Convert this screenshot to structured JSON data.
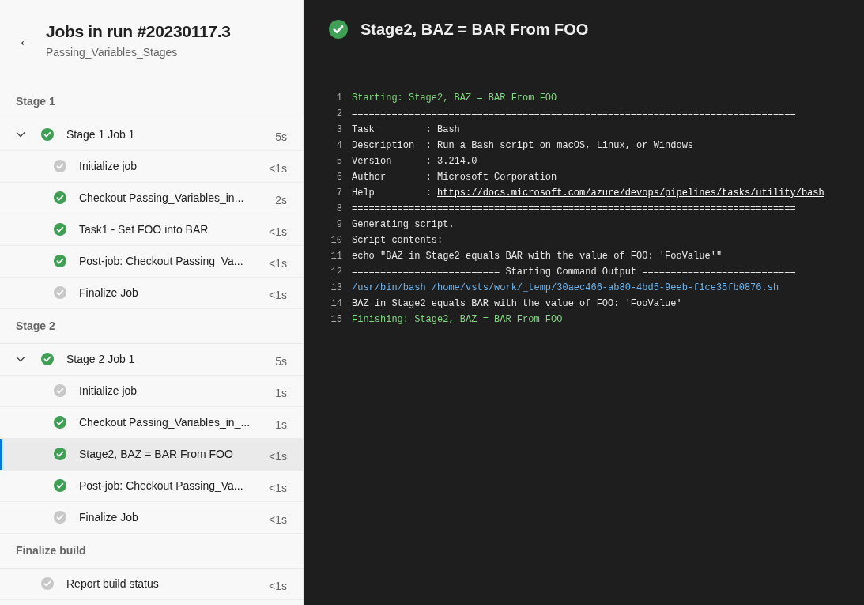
{
  "header": {
    "back": "←",
    "title": "Jobs in run #20230117.3",
    "subtitle": "Passing_Variables_Stages"
  },
  "stages": [
    {
      "name": "Stage 1",
      "jobs": [
        {
          "name": "Stage 1 Job 1",
          "succeeded": true,
          "duration": "5s",
          "expanded": true,
          "steps": [
            {
              "name": "Initialize job",
              "succeeded": false,
              "duration": "<1s",
              "selected": false
            },
            {
              "name": "Checkout Passing_Variables_in...",
              "succeeded": true,
              "duration": "2s",
              "selected": false
            },
            {
              "name": "Task1 - Set FOO into BAR",
              "succeeded": true,
              "duration": "<1s",
              "selected": false
            },
            {
              "name": "Post-job: Checkout Passing_Va...",
              "succeeded": true,
              "duration": "<1s",
              "selected": false
            },
            {
              "name": "Finalize Job",
              "succeeded": false,
              "duration": "<1s",
              "selected": false
            }
          ]
        }
      ]
    },
    {
      "name": "Stage 2",
      "jobs": [
        {
          "name": "Stage 2 Job 1",
          "succeeded": true,
          "duration": "5s",
          "expanded": true,
          "steps": [
            {
              "name": "Initialize job",
              "succeeded": false,
              "duration": "1s",
              "selected": false
            },
            {
              "name": "Checkout Passing_Variables_in_...",
              "succeeded": true,
              "duration": "1s",
              "selected": false
            },
            {
              "name": "Stage2, BAZ = BAR From FOO",
              "succeeded": true,
              "duration": "<1s",
              "selected": true
            },
            {
              "name": "Post-job: Checkout Passing_Va...",
              "succeeded": true,
              "duration": "<1s",
              "selected": false
            },
            {
              "name": "Finalize Job",
              "succeeded": false,
              "duration": "<1s",
              "selected": false
            }
          ]
        }
      ]
    },
    {
      "name": "Finalize build",
      "jobs": [
        {
          "name": "Report build status",
          "succeeded": false,
          "duration": "<1s",
          "expanded": false
        }
      ]
    }
  ],
  "log": {
    "title": "Stage2, BAZ = BAR From FOO",
    "succeeded": true,
    "lines": [
      {
        "number": "1",
        "kind": "section",
        "text": "Starting: Stage2, BAZ = BAR From FOO"
      },
      {
        "number": "2",
        "kind": "plain",
        "text": "=============================================================================="
      },
      {
        "number": "3",
        "kind": "plain",
        "text": "Task         : Bash"
      },
      {
        "number": "4",
        "kind": "plain",
        "text": "Description  : Run a Bash script on macOS, Linux, or Windows"
      },
      {
        "number": "5",
        "kind": "plain",
        "text": "Version      : 3.214.0"
      },
      {
        "number": "6",
        "kind": "plain",
        "text": "Author       : Microsoft Corporation"
      },
      {
        "number": "7",
        "kind": "link",
        "text": "Help         : ",
        "link": "https://docs.microsoft.com/azure/devops/pipelines/tasks/utility/bash"
      },
      {
        "number": "8",
        "kind": "plain",
        "text": "=============================================================================="
      },
      {
        "number": "9",
        "kind": "plain",
        "text": "Generating script."
      },
      {
        "number": "10",
        "kind": "plain",
        "text": "Script contents:"
      },
      {
        "number": "11",
        "kind": "plain",
        "text": "echo \"BAZ in Stage2 equals BAR with the value of FOO: 'FooValue'\""
      },
      {
        "number": "12",
        "kind": "plain",
        "text": "========================== Starting Command Output ==========================="
      },
      {
        "number": "13",
        "kind": "command",
        "text": "/usr/bin/bash /home/vsts/work/_temp/30aec466-ab80-4bd5-9eeb-f1ce35fb0876.sh"
      },
      {
        "number": "14",
        "kind": "plain",
        "text": "BAZ in Stage2 equals BAR with the value of FOO: 'FooValue'"
      },
      {
        "number": "15",
        "kind": "section",
        "text": "Finishing: Stage2, BAZ = BAR From FOO"
      }
    ]
  }
}
